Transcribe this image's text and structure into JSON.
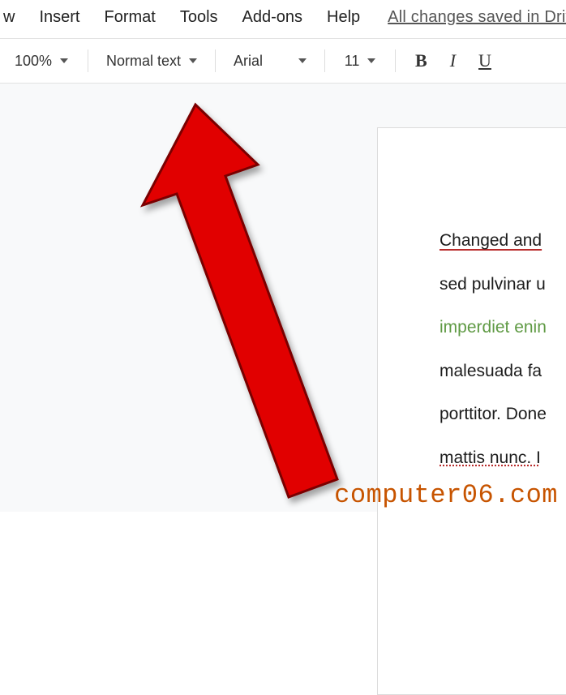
{
  "menubar": {
    "items": [
      {
        "label": "w"
      },
      {
        "label": "Insert"
      },
      {
        "label": "Format"
      },
      {
        "label": "Tools"
      },
      {
        "label": "Add-ons"
      },
      {
        "label": "Help"
      }
    ],
    "saved_status": "All changes saved in Drive"
  },
  "toolbar": {
    "zoom": "100%",
    "paragraph_style": "Normal text",
    "font_family": "Arial",
    "font_size": "11",
    "bold": "B",
    "italic": "I",
    "underline": "U"
  },
  "document": {
    "lines": [
      {
        "text": "Changed and",
        "style": "title"
      },
      {
        "text": "sed pulvinar u",
        "style": "normal"
      },
      {
        "text": "imperdiet enin",
        "style": "green"
      },
      {
        "text": "malesuada fa",
        "style": "normal"
      },
      {
        "text": "porttitor. Done",
        "style": "normal"
      },
      {
        "text": "mattis  nunc. I",
        "style": "pending"
      }
    ]
  },
  "watermark": "computer06.com"
}
